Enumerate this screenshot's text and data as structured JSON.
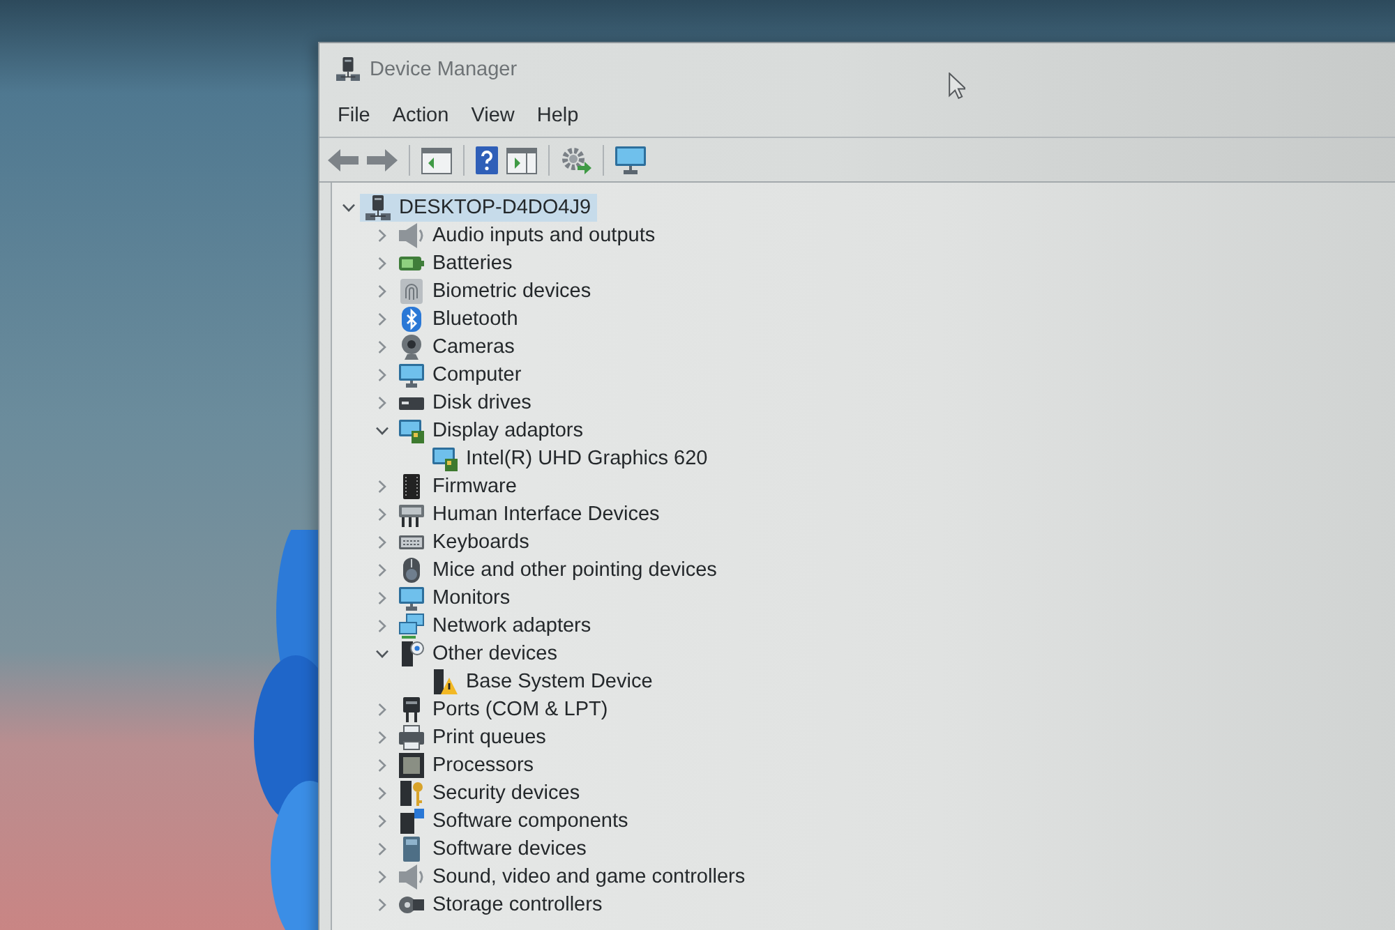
{
  "window": {
    "title": "Device Manager"
  },
  "menu": [
    "File",
    "Action",
    "View",
    "Help"
  ],
  "tree": {
    "label": "DESKTOP-D4DO4J9",
    "expanded": true,
    "selected": true,
    "children": [
      {
        "label": "Audio inputs and outputs",
        "expanded": false,
        "selected": false
      },
      {
        "label": "Batteries",
        "expanded": false,
        "selected": false
      },
      {
        "label": "Biometric devices",
        "expanded": false,
        "selected": false
      },
      {
        "label": "Bluetooth",
        "expanded": false,
        "selected": false
      },
      {
        "label": "Cameras",
        "expanded": false,
        "selected": false
      },
      {
        "label": "Computer",
        "expanded": false,
        "selected": false
      },
      {
        "label": "Disk drives",
        "expanded": false,
        "selected": false
      },
      {
        "label": "Display adaptors",
        "expanded": true,
        "selected": false,
        "children": [
          {
            "label": "Intel(R) UHD Graphics 620",
            "selected": false
          }
        ]
      },
      {
        "label": "Firmware",
        "expanded": false,
        "selected": false
      },
      {
        "label": "Human Interface Devices",
        "expanded": false,
        "selected": false
      },
      {
        "label": "Keyboards",
        "expanded": false,
        "selected": false
      },
      {
        "label": "Mice and other pointing devices",
        "expanded": false,
        "selected": false
      },
      {
        "label": "Monitors",
        "expanded": false,
        "selected": false
      },
      {
        "label": "Network adapters",
        "expanded": false,
        "selected": false
      },
      {
        "label": "Other devices",
        "expanded": true,
        "selected": false,
        "children": [
          {
            "label": "Base System Device",
            "selected": false
          }
        ]
      },
      {
        "label": "Ports (COM & LPT)",
        "expanded": false,
        "selected": false
      },
      {
        "label": "Print queues",
        "expanded": false,
        "selected": false
      },
      {
        "label": "Processors",
        "expanded": false,
        "selected": false
      },
      {
        "label": "Security devices",
        "expanded": false,
        "selected": false
      },
      {
        "label": "Software components",
        "expanded": false,
        "selected": false
      },
      {
        "label": "Software devices",
        "expanded": false,
        "selected": false
      },
      {
        "label": "Sound, video and game controllers",
        "expanded": false,
        "selected": false
      },
      {
        "label": "Storage controllers",
        "expanded": false,
        "selected": false
      }
    ]
  }
}
